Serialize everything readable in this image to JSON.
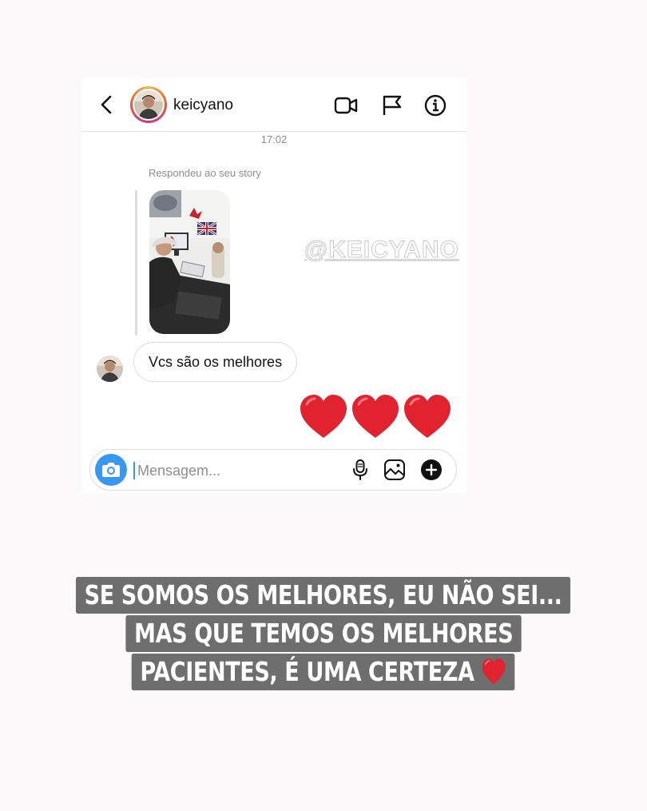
{
  "header": {
    "username": "keicyano"
  },
  "chat": {
    "timestamp": "17:02",
    "story_reply_label": "Respondeu ao seu story",
    "watermark": "@KEICYANO",
    "received_message": "Vcs são os melhores",
    "sent_emojis": [
      "❤️",
      "❤️",
      "❤️"
    ]
  },
  "composer": {
    "placeholder": "Mensagem..."
  },
  "caption": {
    "lines": [
      "SE SOMOS OS MELHORES, EU NÃO SEI...",
      "MAS QUE TEMOS OS MELHORES",
      "PACIENTES, É UMA CERTEZA"
    ],
    "emoji": "❤️"
  },
  "colors": {
    "accent": "#3897f0",
    "heart": "#e0232e",
    "caption_bg": "#6e6e6e",
    "story_ring": "#e05a3c"
  },
  "icons": [
    "back-icon",
    "video-call-icon",
    "flag-icon",
    "info-icon",
    "camera-icon",
    "microphone-icon",
    "gallery-icon",
    "plus-icon",
    "heart-icon"
  ]
}
